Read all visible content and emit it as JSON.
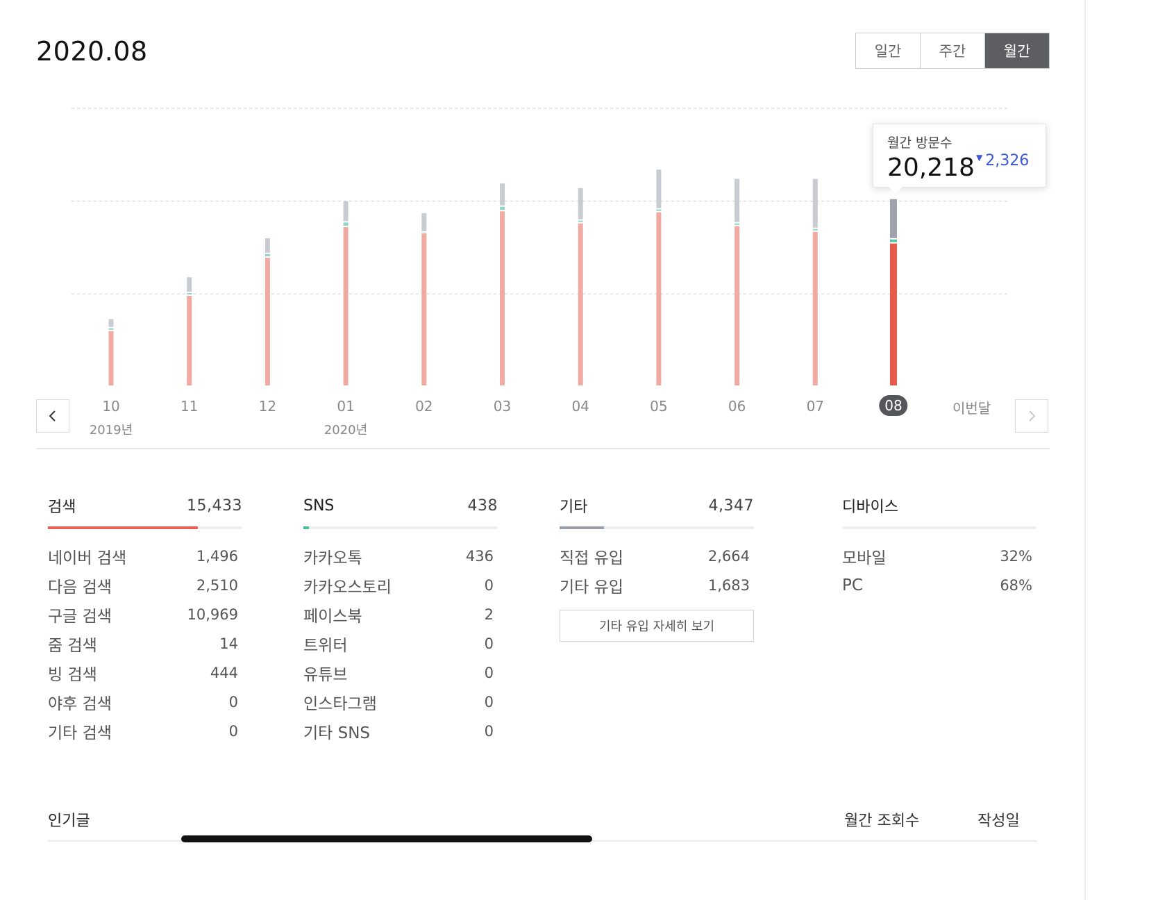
{
  "page": {
    "title": "2020.08"
  },
  "period_tabs": [
    {
      "label": "일간",
      "active": false
    },
    {
      "label": "주간",
      "active": false
    },
    {
      "label": "월간",
      "active": true
    }
  ],
  "nav": {
    "prev_icon": "chevron-left-icon",
    "next_icon": "chevron-right-icon"
  },
  "tooltip": {
    "label": "월간 방문수",
    "value": "20,218",
    "change": "2,326",
    "change_direction": "down"
  },
  "timeline": {
    "months": [
      "10",
      "11",
      "12",
      "01",
      "02",
      "03",
      "04",
      "05",
      "06",
      "07",
      "08"
    ],
    "selected": "08",
    "year_labels": [
      {
        "month": "10",
        "label": "2019년"
      },
      {
        "month": "01",
        "label": "2020년"
      }
    ],
    "current_label": "이번달"
  },
  "chart_data": {
    "type": "bar",
    "stacked": true,
    "categories": [
      "10",
      "11",
      "12",
      "01",
      "02",
      "03",
      "04",
      "05",
      "06",
      "07",
      "08"
    ],
    "series": [
      {
        "name": "검색",
        "color": "#f0aaa2",
        "values": [
          6000,
          9800,
          13900,
          17200,
          16500,
          18900,
          17600,
          18800,
          17300,
          16700,
          15433
        ]
      },
      {
        "name": "SNS",
        "color": "#8fd6c7",
        "values": [
          300,
          300,
          400,
          500,
          100,
          500,
          300,
          300,
          300,
          300,
          438
        ]
      },
      {
        "name": "기타",
        "color": "#c8ccd2",
        "values": [
          1000,
          1700,
          1700,
          2300,
          2100,
          2500,
          3500,
          4300,
          4800,
          5400,
          4347
        ]
      }
    ],
    "highlight_colors": {
      "검색": "#e85a4a",
      "SNS": "#5cc4ae",
      "기타": "#9da2ab"
    },
    "ylim": [
      0,
      30000
    ],
    "grid": true,
    "selected_index": 10
  },
  "stats": {
    "search": {
      "label": "검색",
      "total": "15,433",
      "bar_ratio": 0.77,
      "bar_color": "#e8604f",
      "rows": [
        {
          "k": "네이버 검색",
          "v": "1,496"
        },
        {
          "k": "다음 검색",
          "v": "2,510"
        },
        {
          "k": "구글 검색",
          "v": "10,969"
        },
        {
          "k": "줌 검색",
          "v": "14"
        },
        {
          "k": "빙 검색",
          "v": "444"
        },
        {
          "k": "야후 검색",
          "v": "0"
        },
        {
          "k": "기타 검색",
          "v": "0"
        }
      ]
    },
    "sns": {
      "label": "SNS",
      "total": "438",
      "bar_ratio": 0.03,
      "bar_color": "#3fbfa4",
      "rows": [
        {
          "k": "카카오톡",
          "v": "436"
        },
        {
          "k": "카카오스토리",
          "v": "0"
        },
        {
          "k": "페이스북",
          "v": "2"
        },
        {
          "k": "트위터",
          "v": "0"
        },
        {
          "k": "유튜브",
          "v": "0"
        },
        {
          "k": "인스타그램",
          "v": "0"
        },
        {
          "k": "기타 SNS",
          "v": "0"
        }
      ]
    },
    "etc": {
      "label": "기타",
      "total": "4,347",
      "bar_ratio": 0.23,
      "bar_color": "#9aa0a9",
      "rows": [
        {
          "k": "직접 유입",
          "v": "2,664"
        },
        {
          "k": "기타 유입",
          "v": "1,683"
        }
      ],
      "detail_button": "기타 유입 자세히 보기"
    },
    "device": {
      "label": "디바이스",
      "rows": [
        {
          "k": "모바일",
          "v": "32%"
        },
        {
          "k": "PC",
          "v": "68%"
        }
      ]
    }
  },
  "popular": {
    "title": "인기글",
    "col_views": "월간 조회수",
    "col_date": "작성일"
  }
}
